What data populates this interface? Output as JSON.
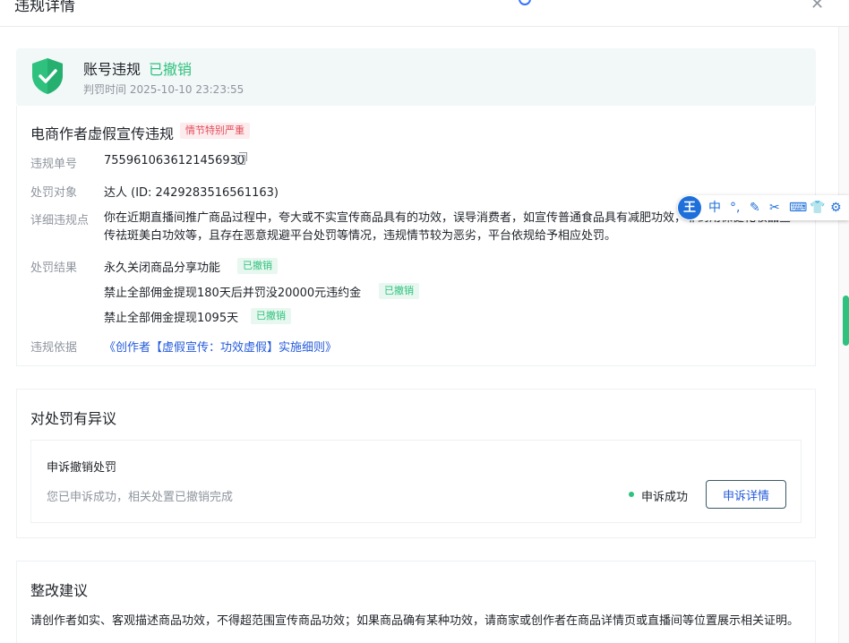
{
  "header": {
    "title": "违规详情",
    "close_glyph": "✕"
  },
  "status": {
    "icon": "shield-check-icon",
    "title": "账号违规",
    "badge": "已撤销",
    "time_label": "判罚时间 2025-10-10 23:23:55"
  },
  "violation": {
    "title": "电商作者虚假宣传违规",
    "severity": "情节特别严重",
    "fields": {
      "id_label": "违规单号",
      "id_value": "7559610636121456930",
      "target_label": "处罚对象",
      "target_value": "达人 (ID: 2429283516561163)",
      "detail_label": "详细违规点",
      "detail_value": "你在近期直播间推广商品过程中，夸大或不实宣传商品具有的功效，误导消费者，如宣传普通食品具有减肥功效，非药用保健化妆品宣传祛斑美白功效等，且存在恶意规避平台处罚等情况，违规情节较为恶劣，平台依规给予相应处罚。",
      "result_label": "处罚结果",
      "results": [
        {
          "text": "永久关闭商品分享功能",
          "tag": "已撤销"
        },
        {
          "text": "禁止全部佣金提现180天后并罚没20000元违约金",
          "tag": "已撤销"
        },
        {
          "text": "禁止全部佣金提现1095天",
          "tag": "已撤销"
        }
      ],
      "basis_label": "违规依据",
      "basis_link": "《创作者【虚假宣传：功效虚假】实施细则》"
    }
  },
  "appeal": {
    "heading": "对处罚有异议",
    "title": "申诉撤销处罚",
    "desc": "您已申诉成功，相关处置已撤销完成",
    "status": "申诉成功",
    "button": "申诉详情"
  },
  "rectify": {
    "heading": "整改建议",
    "text": "请创作者如实、客观描述商品功效，不得超范围宣传商品功效；如果商品确有某种功效，请商家或创作者在商品详情页或直播间等位置展示相关证明。"
  },
  "ime": {
    "logo": "王",
    "items": [
      "中",
      "°,",
      "✎",
      "✂",
      "⌨",
      "👕",
      "⚙"
    ]
  },
  "colors": {
    "accent_green": "#2ec27e",
    "link_blue": "#245bdb",
    "danger_red": "#e34d59",
    "ime_blue": "#1e6fd9"
  }
}
